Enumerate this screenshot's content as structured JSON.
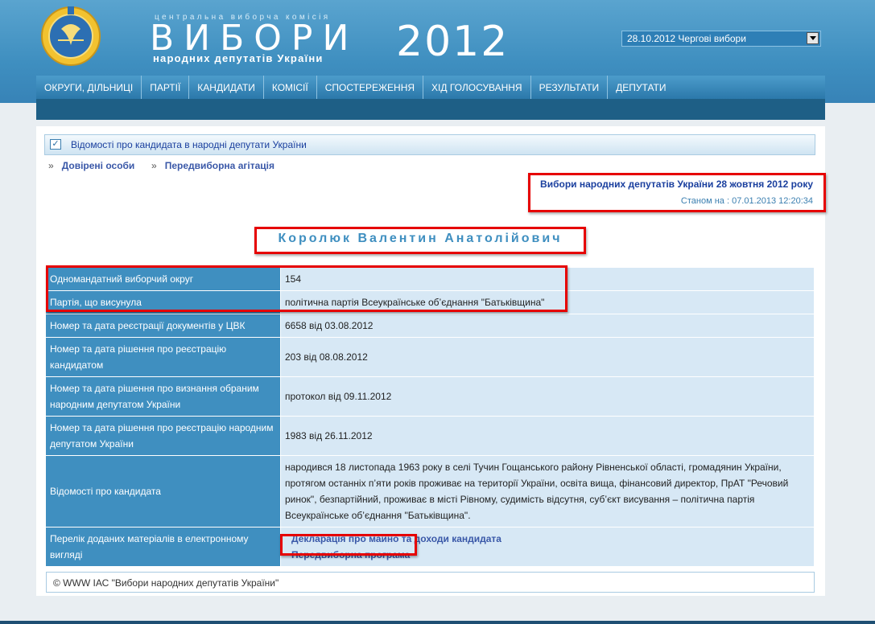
{
  "header": {
    "brand_top": "центральна виборча комісія",
    "brand_main": "ВИБОРИ",
    "brand_sub": "народних депутатів України",
    "brand_year": "2012",
    "election_select": "28.10.2012 Чергові вибори"
  },
  "nav": {
    "items": [
      {
        "label": "ОКРУГИ, ДІЛЬНИЦІ"
      },
      {
        "label": "ПАРТІЇ"
      },
      {
        "label": "КАНДИДАТИ"
      },
      {
        "label": "КОМІСІЇ"
      },
      {
        "label": "СПОСТЕРЕЖЕННЯ"
      },
      {
        "label": "ХІД ГОЛОСУВАННЯ"
      },
      {
        "label": "РЕЗУЛЬТАТИ"
      },
      {
        "label": "ДЕПУТАТИ"
      }
    ]
  },
  "section": {
    "title": "Відомості про кандидата в народні депутати України"
  },
  "subnav": {
    "trusted": "Довірені особи",
    "campaign": "Передвиборна агітація"
  },
  "election_info": {
    "title": "Вибори народних депутатів України 28 жовтня 2012 року",
    "as_of": "Станом на : 07.01.2013 12:20:34"
  },
  "candidate": {
    "name": "Королюк Валентин Анатолійович"
  },
  "table": {
    "rows": [
      {
        "label": "Одномандатний виборчий округ",
        "value": "154"
      },
      {
        "label": "Партія, що висунула",
        "value": "політична партія Всеукраїнське об’єднання \"Батьківщина\""
      },
      {
        "label": "Номер та дата реєстрації документів у ЦВК",
        "value": "6658 від 03.08.2012"
      },
      {
        "label": "Номер та дата рішення про реєстрацію кандидатом",
        "value": "203 від 08.08.2012"
      },
      {
        "label": "Номер та дата рішення про визнання обраним народним депутатом України",
        "value": "протокол від 09.11.2012"
      },
      {
        "label": "Номер та дата рішення про реєстрацію народним депутатом України",
        "value": "1983 від 26.11.2012"
      },
      {
        "label": "Відомості про кандидата",
        "value": "народився 18 листопада 1963 року в селі Тучин Гощанського району Рівненської області, громадянин України, протягом останніх п’яти років проживає на території України, освіта вища, фінансовий директор, ПрАТ \"Речовий ринок\", безпартійний, проживає в місті Рівному, судимість відсутня, суб’єкт висування – політична партія Всеукраїнське об’єднання \"Батьківщина\"."
      },
      {
        "label": "Перелік доданих матеріалів в електронному вигляді"
      }
    ],
    "links": {
      "declaration": "Декларація про майно та доходи кандидата",
      "program": "Передвиборна програма"
    }
  },
  "footer": {
    "text": "© WWW ІАС \"Вибори народних депутатів України\""
  },
  "colors": {
    "header_blue": "#3f8fc0",
    "label_cell": "#3f8fc0",
    "value_cell": "#d7e8f5",
    "link": "#3a58a8",
    "highlight": "#e60000"
  },
  "icons": {
    "emblem": "cec-emblem-icon",
    "section": "checkbox-icon",
    "select_arrow": "dropdown-arrow-icon"
  }
}
